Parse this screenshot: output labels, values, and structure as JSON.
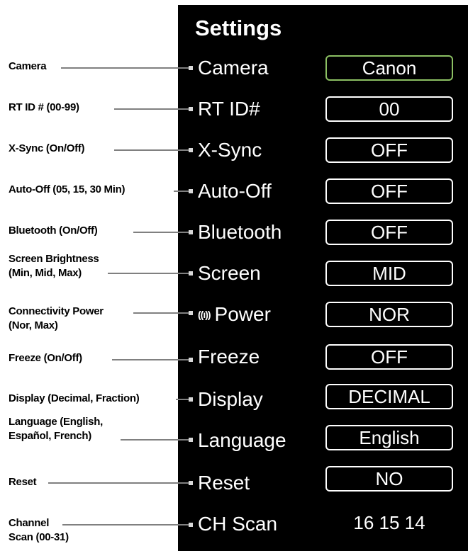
{
  "title": "Settings",
  "accent_color": "#8cc063",
  "rows": [
    {
      "annotation": [
        "Camera"
      ],
      "label": "Camera",
      "value": "Canon",
      "selected": true
    },
    {
      "annotation": [
        "RT ID # (00-99)"
      ],
      "label": "RT ID#",
      "value": "00"
    },
    {
      "annotation": [
        "X-Sync (On/Off)"
      ],
      "label": "X-Sync",
      "value": "OFF"
    },
    {
      "annotation": [
        "Auto-Off (05, 15, 30 Min)"
      ],
      "label": "Auto-Off",
      "value": "OFF"
    },
    {
      "annotation": [
        "Bluetooth (On/Off)"
      ],
      "label": "Bluetooth",
      "value": "OFF"
    },
    {
      "annotation": [
        "Screen Brightness",
        "(Min, Mid, Max)"
      ],
      "label": "Screen",
      "value": "MID"
    },
    {
      "annotation": [
        "Connectivity Power",
        "(Nor, Max)"
      ],
      "label": "Power",
      "icon": "wireless-signal-icon",
      "icon_glyph": "((ı))",
      "value": "NOR"
    },
    {
      "annotation": [
        "Freeze (On/Off)"
      ],
      "label": "Freeze",
      "value": "OFF"
    },
    {
      "annotation": [
        "Display (Decimal, Fraction)"
      ],
      "label": "Display",
      "value": "DECIMAL"
    },
    {
      "annotation": [
        "Language (English,",
        "Español, French)"
      ],
      "label": "Language",
      "value": "English"
    },
    {
      "annotation": [
        "Reset"
      ],
      "label": "Reset",
      "value": "NO"
    },
    {
      "annotation": [
        "Channel",
        "Scan (00-31)"
      ],
      "label": "CH Scan",
      "value": "16 15 14",
      "boxed": false
    }
  ]
}
